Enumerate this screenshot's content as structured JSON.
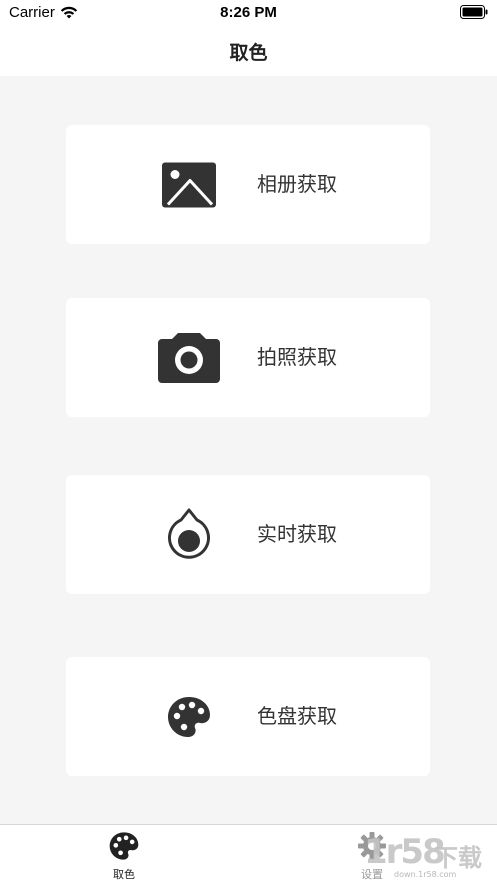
{
  "status_bar": {
    "carrier": "Carrier",
    "time": "8:26 PM",
    "wifi_icon": "wifi-icon",
    "battery_icon": "battery-icon"
  },
  "nav": {
    "title": "取色"
  },
  "cards": [
    {
      "label": "相册获取",
      "icon": "image-icon"
    },
    {
      "label": "拍照获取",
      "icon": "camera-icon"
    },
    {
      "label": "实时获取",
      "icon": "drop-icon"
    },
    {
      "label": "色盘获取",
      "icon": "palette-icon"
    }
  ],
  "tab_bar": {
    "tabs": [
      {
        "label": "取色",
        "icon": "palette-icon",
        "active": true
      },
      {
        "label": "设置",
        "icon": "gear-icon",
        "active": false
      }
    ]
  },
  "watermark": {
    "number": "1r58",
    "text": "下载",
    "url": "down.1r58.com"
  },
  "colors": {
    "background": "#f5f5f5",
    "card": "#ffffff",
    "icon": "#333333",
    "text": "#333333"
  }
}
